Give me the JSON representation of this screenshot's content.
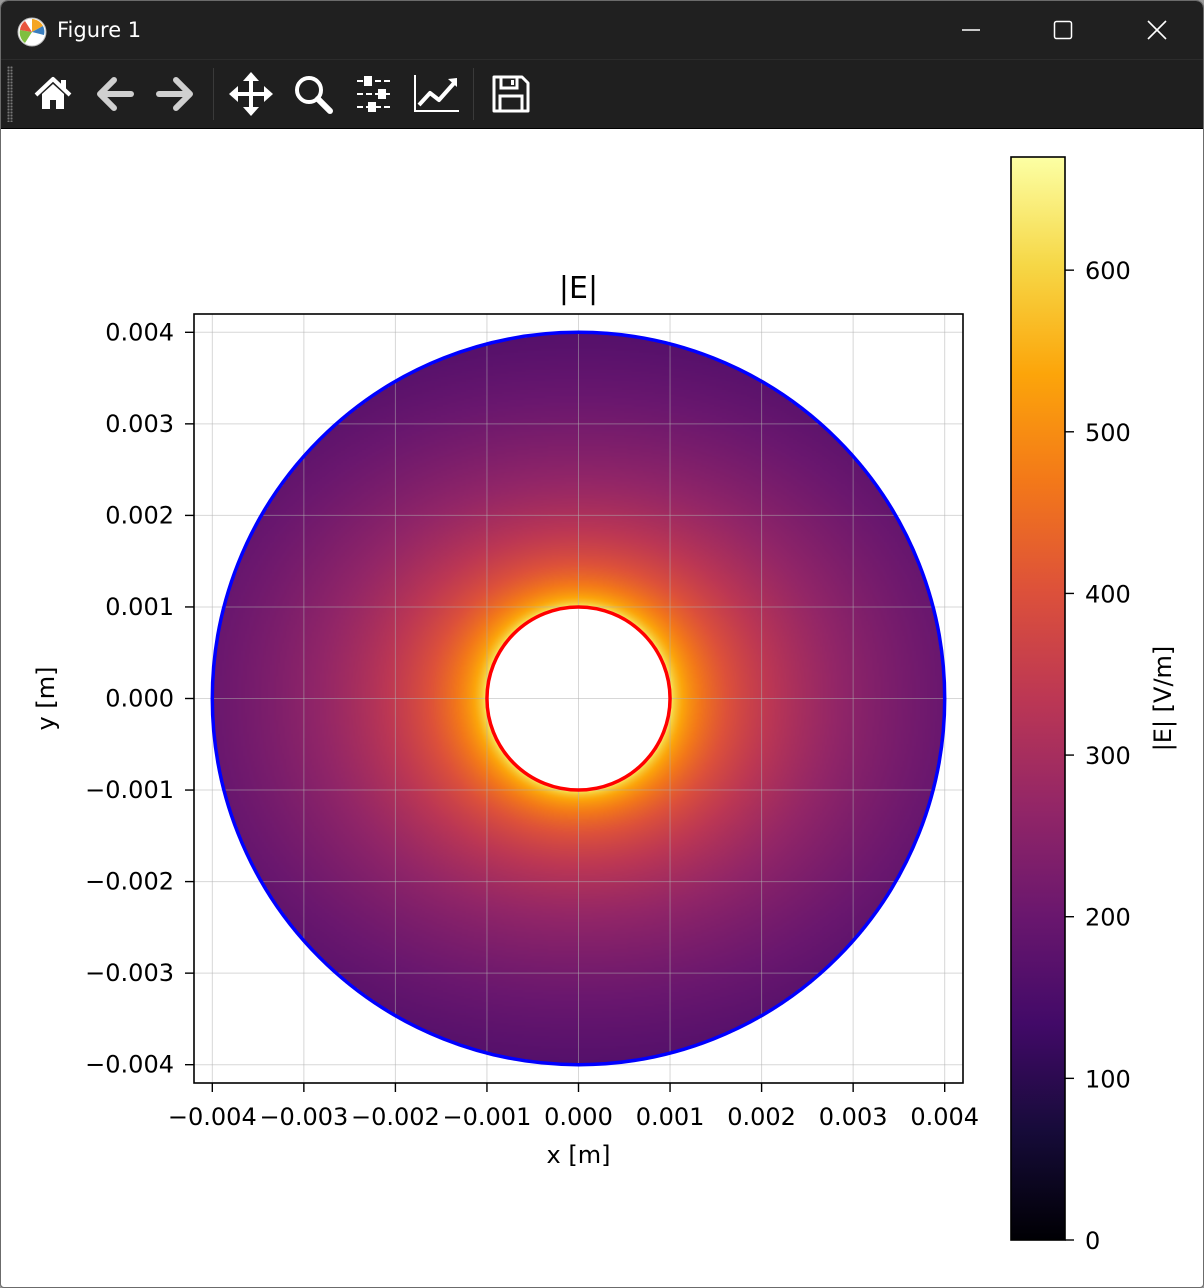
{
  "window": {
    "title": "Figure 1",
    "icon": "matplotlib-logo-icon",
    "controls": [
      "minimize-icon",
      "maximize-icon",
      "close-icon"
    ]
  },
  "toolbar": {
    "tools": [
      {
        "name": "home",
        "icon": "home-icon"
      },
      {
        "name": "back",
        "icon": "arrow-left-icon"
      },
      {
        "name": "forward",
        "icon": "arrow-right-icon"
      },
      {
        "name": "pan",
        "icon": "move-icon"
      },
      {
        "name": "zoom",
        "icon": "magnifier-icon"
      },
      {
        "name": "subplots",
        "icon": "sliders-icon"
      },
      {
        "name": "edit-axes",
        "icon": "line-chart-icon"
      },
      {
        "name": "save",
        "icon": "floppy-disk-icon"
      }
    ]
  },
  "chart_data": {
    "type": "heatmap",
    "title": "|E|",
    "xlabel": "x [m]",
    "ylabel": "y [m]",
    "xlim": [
      -0.0042,
      0.0042
    ],
    "ylim": [
      -0.0042,
      0.0042
    ],
    "xticks": [
      -0.004,
      -0.003,
      -0.002,
      -0.001,
      0.0,
      0.001,
      0.002,
      0.003,
      0.004
    ],
    "xtick_labels": [
      "−0.004",
      "−0.003",
      "−0.002",
      "−0.001",
      "0.000",
      "0.001",
      "0.002",
      "0.003",
      "0.004"
    ],
    "yticks": [
      0.004,
      0.003,
      0.002,
      0.001,
      0.0,
      -0.001,
      -0.002,
      -0.003,
      -0.004
    ],
    "ytick_labels": [
      "0.004",
      "0.003",
      "0.002",
      "0.001",
      "0.000",
      "−0.001",
      "−0.002",
      "−0.003",
      "−0.004"
    ],
    "grid": true,
    "colormap": "inferno",
    "field": {
      "inner_radius": 0.001,
      "outer_radius": 0.004,
      "e_at_inner": 670,
      "e_at_outer_along_x": 200,
      "e_at_outer_along_y": 165
    },
    "contours": [
      {
        "radius": 0.001,
        "color": "#ff0000"
      },
      {
        "radius": 0.004,
        "color": "#0000ff"
      }
    ],
    "colorbar": {
      "label": "|E| [V/m]",
      "range": [
        0,
        670
      ],
      "ticks": [
        0,
        100,
        200,
        300,
        400,
        500,
        600
      ],
      "tick_labels": [
        "0",
        "100",
        "200",
        "300",
        "400",
        "500",
        "600"
      ]
    }
  }
}
